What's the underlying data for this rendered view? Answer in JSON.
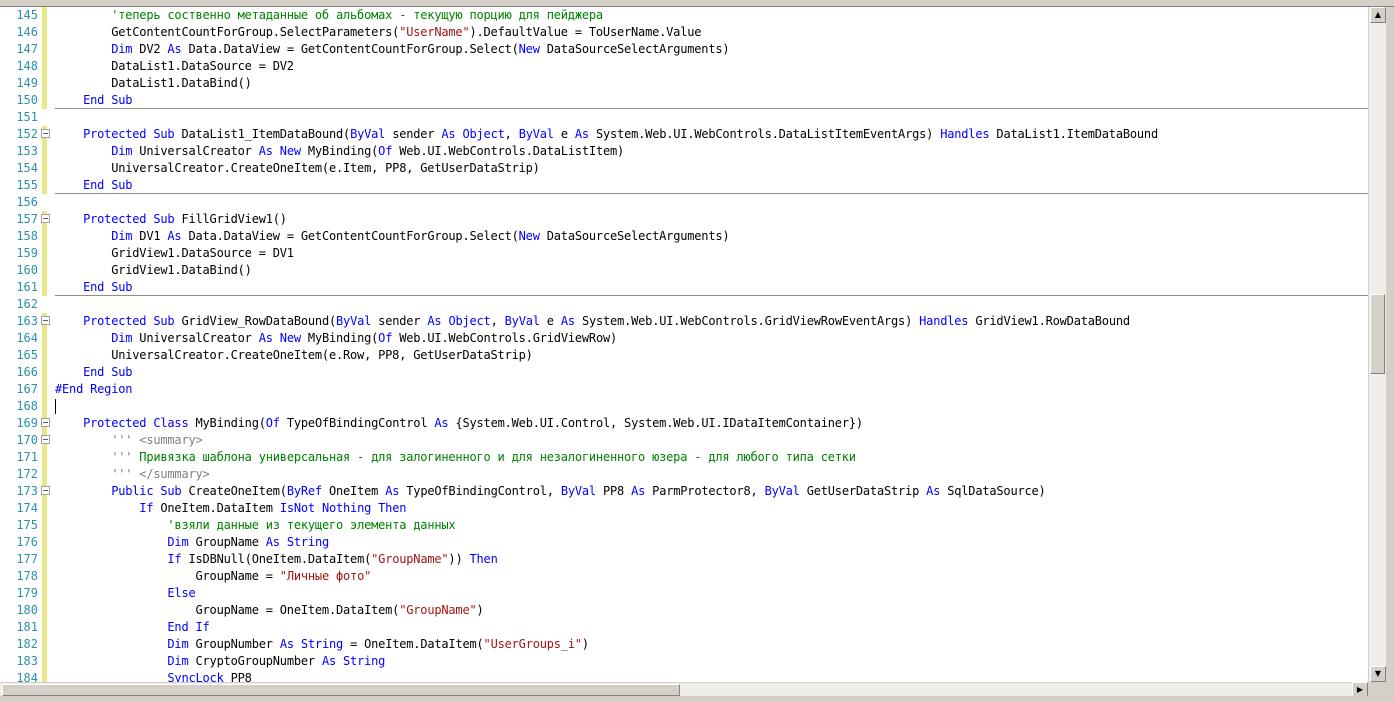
{
  "editor": {
    "lines": [
      {
        "n": "145",
        "bar": true,
        "fold": false,
        "sepAfter": false,
        "t": [
          [
            "cm",
            "        'теперь соственно метаданные об альбомах - текущую порцию для пейджера"
          ]
        ]
      },
      {
        "n": "146",
        "bar": true,
        "fold": false,
        "sepAfter": false,
        "t": [
          [
            "",
            "        GetContentCountForGroup.SelectParameters("
          ],
          [
            "str",
            "\"UserName\""
          ],
          [
            "",
            ").DefaultValue = ToUserName.Value"
          ]
        ]
      },
      {
        "n": "147",
        "bar": true,
        "fold": false,
        "sepAfter": false,
        "t": [
          [
            "",
            "        "
          ],
          [
            "kw",
            "Dim"
          ],
          [
            "",
            " DV2 "
          ],
          [
            "kw",
            "As"
          ],
          [
            "",
            " Data.DataView = GetContentCountForGroup.Select("
          ],
          [
            "kw",
            "New"
          ],
          [
            "",
            " DataSourceSelectArguments)"
          ]
        ]
      },
      {
        "n": "148",
        "bar": true,
        "fold": false,
        "sepAfter": false,
        "t": [
          [
            "",
            "        DataList1.DataSource = DV2"
          ]
        ]
      },
      {
        "n": "149",
        "bar": true,
        "fold": false,
        "sepAfter": false,
        "t": [
          [
            "",
            "        DataList1.DataBind()"
          ]
        ]
      },
      {
        "n": "150",
        "bar": true,
        "fold": false,
        "sepAfter": true,
        "t": [
          [
            "",
            "    "
          ],
          [
            "kw",
            "End Sub"
          ]
        ]
      },
      {
        "n": "151",
        "bar": false,
        "fold": false,
        "sepAfter": false,
        "t": []
      },
      {
        "n": "152",
        "bar": true,
        "fold": true,
        "sepAfter": false,
        "t": [
          [
            "",
            "    "
          ],
          [
            "kw",
            "Protected Sub"
          ],
          [
            "",
            " DataList1_ItemDataBound("
          ],
          [
            "kw",
            "ByVal"
          ],
          [
            "",
            " sender "
          ],
          [
            "kw",
            "As"
          ],
          [
            "",
            " "
          ],
          [
            "kw",
            "Object"
          ],
          [
            "",
            ", "
          ],
          [
            "kw",
            "ByVal"
          ],
          [
            "",
            " e "
          ],
          [
            "kw",
            "As"
          ],
          [
            "",
            " System.Web.UI.WebControls.DataListItemEventArgs) "
          ],
          [
            "kw",
            "Handles"
          ],
          [
            "",
            " DataList1.ItemDataBound"
          ]
        ]
      },
      {
        "n": "153",
        "bar": true,
        "fold": false,
        "sepAfter": false,
        "t": [
          [
            "",
            "        "
          ],
          [
            "kw",
            "Dim"
          ],
          [
            "",
            " UniversalCreator "
          ],
          [
            "kw",
            "As New"
          ],
          [
            "",
            " MyBinding("
          ],
          [
            "kw",
            "Of"
          ],
          [
            "",
            " Web.UI.WebControls.DataListItem)"
          ]
        ]
      },
      {
        "n": "154",
        "bar": true,
        "fold": false,
        "sepAfter": false,
        "t": [
          [
            "",
            "        UniversalCreator.CreateOneItem(e.Item, PP8, GetUserDataStrip)"
          ]
        ]
      },
      {
        "n": "155",
        "bar": true,
        "fold": false,
        "sepAfter": true,
        "t": [
          [
            "",
            "    "
          ],
          [
            "kw",
            "End Sub"
          ]
        ]
      },
      {
        "n": "156",
        "bar": false,
        "fold": false,
        "sepAfter": false,
        "t": []
      },
      {
        "n": "157",
        "bar": true,
        "fold": true,
        "sepAfter": false,
        "t": [
          [
            "",
            "    "
          ],
          [
            "kw",
            "Protected Sub"
          ],
          [
            "",
            " FillGridView1()"
          ]
        ]
      },
      {
        "n": "158",
        "bar": true,
        "fold": false,
        "sepAfter": false,
        "t": [
          [
            "",
            "        "
          ],
          [
            "kw",
            "Dim"
          ],
          [
            "",
            " DV1 "
          ],
          [
            "kw",
            "As"
          ],
          [
            "",
            " Data.DataView = GetContentCountForGroup.Select("
          ],
          [
            "kw",
            "New"
          ],
          [
            "",
            " DataSourceSelectArguments)"
          ]
        ]
      },
      {
        "n": "159",
        "bar": true,
        "fold": false,
        "sepAfter": false,
        "t": [
          [
            "",
            "        GridView1.DataSource = DV1"
          ]
        ]
      },
      {
        "n": "160",
        "bar": true,
        "fold": false,
        "sepAfter": false,
        "t": [
          [
            "",
            "        GridView1.DataBind()"
          ]
        ]
      },
      {
        "n": "161",
        "bar": true,
        "fold": false,
        "sepAfter": true,
        "t": [
          [
            "",
            "    "
          ],
          [
            "kw",
            "End Sub"
          ]
        ]
      },
      {
        "n": "162",
        "bar": false,
        "fold": false,
        "sepAfter": false,
        "t": []
      },
      {
        "n": "163",
        "bar": true,
        "fold": true,
        "sepAfter": false,
        "t": [
          [
            "",
            "    "
          ],
          [
            "kw",
            "Protected Sub"
          ],
          [
            "",
            " GridView_RowDataBound("
          ],
          [
            "kw",
            "ByVal"
          ],
          [
            "",
            " sender "
          ],
          [
            "kw",
            "As"
          ],
          [
            "",
            " "
          ],
          [
            "kw",
            "Object"
          ],
          [
            "",
            ", "
          ],
          [
            "kw",
            "ByVal"
          ],
          [
            "",
            " e "
          ],
          [
            "kw",
            "As"
          ],
          [
            "",
            " System.Web.UI.WebControls.GridViewRowEventArgs) "
          ],
          [
            "kw",
            "Handles"
          ],
          [
            "",
            " GridView1.RowDataBound"
          ]
        ]
      },
      {
        "n": "164",
        "bar": true,
        "fold": false,
        "sepAfter": false,
        "t": [
          [
            "",
            "        "
          ],
          [
            "kw",
            "Dim"
          ],
          [
            "",
            " UniversalCreator "
          ],
          [
            "kw",
            "As New"
          ],
          [
            "",
            " MyBinding("
          ],
          [
            "kw",
            "Of"
          ],
          [
            "",
            " Web.UI.WebControls.GridViewRow)"
          ]
        ]
      },
      {
        "n": "165",
        "bar": true,
        "fold": false,
        "sepAfter": false,
        "t": [
          [
            "",
            "        UniversalCreator.CreateOneItem(e.Row, PP8, GetUserDataStrip)"
          ]
        ]
      },
      {
        "n": "166",
        "bar": true,
        "fold": false,
        "sepAfter": false,
        "t": [
          [
            "",
            "    "
          ],
          [
            "kw",
            "End Sub"
          ]
        ]
      },
      {
        "n": "167",
        "bar": true,
        "fold": false,
        "sepAfter": false,
        "t": [
          [
            "kw",
            "#End Region"
          ]
        ]
      },
      {
        "n": "168",
        "bar": true,
        "fold": false,
        "sepAfter": false,
        "caret": true,
        "t": []
      },
      {
        "n": "169",
        "bar": true,
        "fold": true,
        "sepAfter": false,
        "t": [
          [
            "",
            "    "
          ],
          [
            "kw",
            "Protected Class"
          ],
          [
            "",
            " MyBinding("
          ],
          [
            "kw",
            "Of"
          ],
          [
            "",
            " TypeOfBindingControl "
          ],
          [
            "kw",
            "As"
          ],
          [
            "",
            " {System.Web.UI.Control, System.Web.UI.IDataItemContainer})"
          ]
        ]
      },
      {
        "n": "170",
        "bar": true,
        "fold": true,
        "sepAfter": false,
        "t": [
          [
            "",
            "        "
          ],
          [
            "xml",
            "''' <summary>"
          ]
        ]
      },
      {
        "n": "171",
        "bar": true,
        "fold": false,
        "sepAfter": false,
        "t": [
          [
            "",
            "        "
          ],
          [
            "xml",
            "'''"
          ],
          [
            "cm",
            " Привязка шаблона универсальная - для залогиненного и для незалогиненного юзера - для любого типа сетки"
          ]
        ]
      },
      {
        "n": "172",
        "bar": true,
        "fold": false,
        "sepAfter": false,
        "t": [
          [
            "",
            "        "
          ],
          [
            "xml",
            "''' </summary>"
          ]
        ]
      },
      {
        "n": "173",
        "bar": true,
        "fold": true,
        "sepAfter": false,
        "t": [
          [
            "",
            "        "
          ],
          [
            "kw",
            "Public Sub"
          ],
          [
            "",
            " CreateOneItem("
          ],
          [
            "kw",
            "ByRef"
          ],
          [
            "",
            " OneItem "
          ],
          [
            "kw",
            "As"
          ],
          [
            "",
            " TypeOfBindingControl, "
          ],
          [
            "kw",
            "ByVal"
          ],
          [
            "",
            " PP8 "
          ],
          [
            "kw",
            "As"
          ],
          [
            "",
            " ParmProtector8, "
          ],
          [
            "kw",
            "ByVal"
          ],
          [
            "",
            " GetUserDataStrip "
          ],
          [
            "kw",
            "As"
          ],
          [
            "",
            " SqlDataSource)"
          ]
        ]
      },
      {
        "n": "174",
        "bar": true,
        "fold": false,
        "sepAfter": false,
        "t": [
          [
            "",
            "            "
          ],
          [
            "kw",
            "If"
          ],
          [
            "",
            " OneItem.DataItem "
          ],
          [
            "kw",
            "IsNot Nothing Then"
          ]
        ]
      },
      {
        "n": "175",
        "bar": true,
        "fold": false,
        "sepAfter": false,
        "t": [
          [
            "",
            "                "
          ],
          [
            "cm",
            "'взяли данные из текущего элемента данных"
          ]
        ]
      },
      {
        "n": "176",
        "bar": true,
        "fold": false,
        "sepAfter": false,
        "t": [
          [
            "",
            "                "
          ],
          [
            "kw",
            "Dim"
          ],
          [
            "",
            " GroupName "
          ],
          [
            "kw",
            "As String"
          ]
        ]
      },
      {
        "n": "177",
        "bar": true,
        "fold": false,
        "sepAfter": false,
        "t": [
          [
            "",
            "                "
          ],
          [
            "kw",
            "If"
          ],
          [
            "",
            " IsDBNull(OneItem.DataItem("
          ],
          [
            "str",
            "\"GroupName\""
          ],
          [
            "",
            ")) "
          ],
          [
            "kw",
            "Then"
          ]
        ]
      },
      {
        "n": "178",
        "bar": true,
        "fold": false,
        "sepAfter": false,
        "t": [
          [
            "",
            "                    GroupName = "
          ],
          [
            "str",
            "\"Личные фото\""
          ]
        ]
      },
      {
        "n": "179",
        "bar": true,
        "fold": false,
        "sepAfter": false,
        "t": [
          [
            "",
            "                "
          ],
          [
            "kw",
            "Else"
          ]
        ]
      },
      {
        "n": "180",
        "bar": true,
        "fold": false,
        "sepAfter": false,
        "t": [
          [
            "",
            "                    GroupName = OneItem.DataItem("
          ],
          [
            "str",
            "\"GroupName\""
          ],
          [
            "",
            ")"
          ]
        ]
      },
      {
        "n": "181",
        "bar": true,
        "fold": false,
        "sepAfter": false,
        "t": [
          [
            "",
            "                "
          ],
          [
            "kw",
            "End If"
          ]
        ]
      },
      {
        "n": "182",
        "bar": true,
        "fold": false,
        "sepAfter": false,
        "t": [
          [
            "",
            "                "
          ],
          [
            "kw",
            "Dim"
          ],
          [
            "",
            " GroupNumber "
          ],
          [
            "kw",
            "As String"
          ],
          [
            "",
            " = OneItem.DataItem("
          ],
          [
            "str",
            "\"UserGroups_i\""
          ],
          [
            "",
            ")"
          ]
        ]
      },
      {
        "n": "183",
        "bar": true,
        "fold": false,
        "sepAfter": false,
        "t": [
          [
            "",
            "                "
          ],
          [
            "kw",
            "Dim"
          ],
          [
            "",
            " CryptoGroupNumber "
          ],
          [
            "kw",
            "As String"
          ]
        ]
      },
      {
        "n": "184",
        "bar": true,
        "fold": false,
        "sepAfter": false,
        "t": [
          [
            "",
            "                "
          ],
          [
            "kw",
            "SyncLock"
          ],
          [
            "",
            " PP8"
          ]
        ]
      }
    ]
  },
  "scrollbars": {
    "vertical_up": "▲",
    "vertical_down": "▼",
    "horizontal_left": "◀",
    "horizontal_right": "▶"
  }
}
